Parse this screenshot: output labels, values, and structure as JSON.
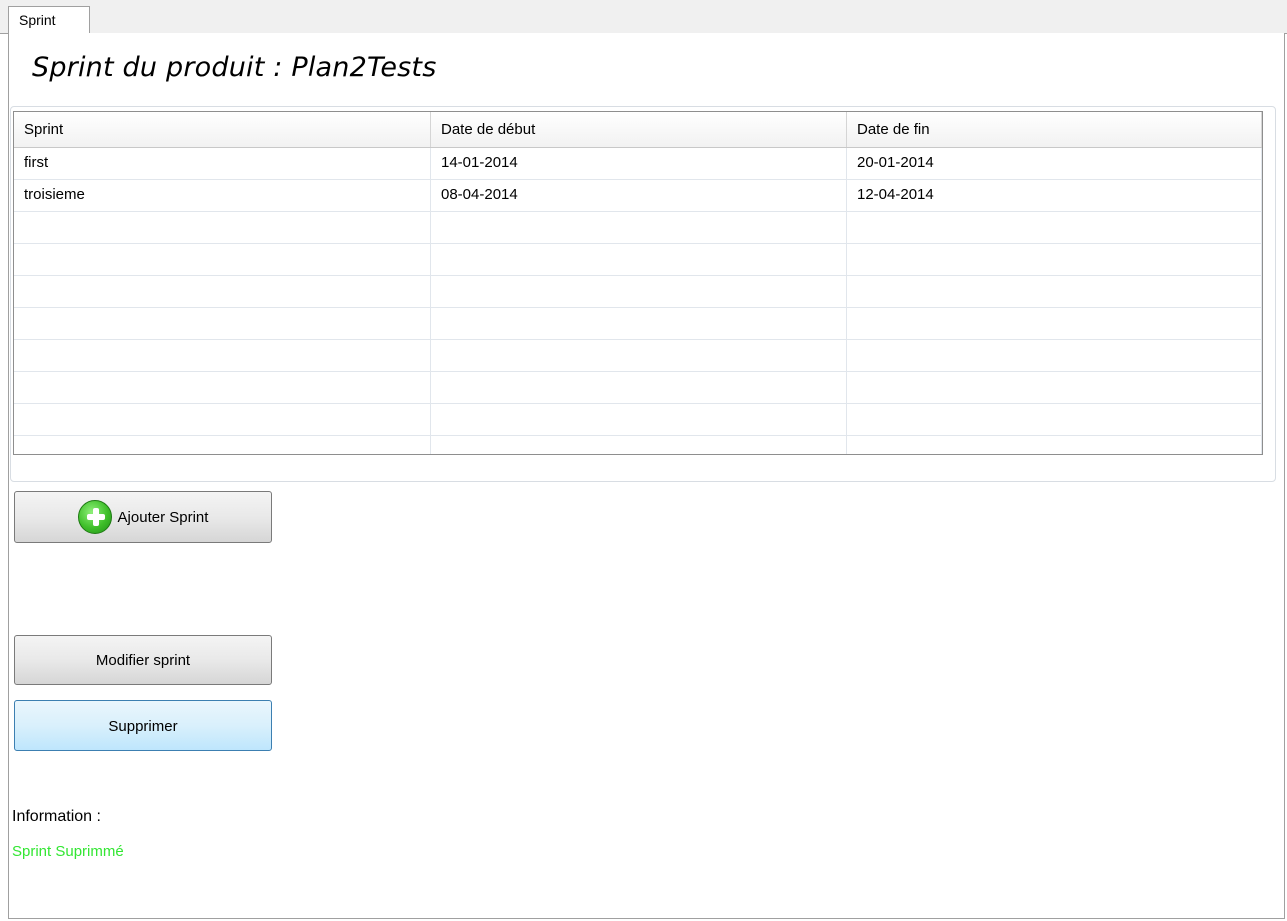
{
  "tab": {
    "label": "Sprint"
  },
  "title": "Sprint du produit : Plan2Tests",
  "table": {
    "columns": [
      "Sprint",
      "Date de début",
      "Date de fin"
    ],
    "rows": [
      [
        "first",
        "14-01-2014",
        "20-01-2014"
      ],
      [
        "troisieme",
        "08-04-2014",
        "12-04-2014"
      ]
    ]
  },
  "buttons": {
    "add_label": "Ajouter Sprint",
    "modify_label": "Modifier sprint",
    "delete_label": "Supprimer"
  },
  "info": {
    "label": "Information :",
    "message": "Sprint Suprimmé",
    "message_color": "#33e633"
  },
  "icons": {
    "add": "plus-circle-icon"
  }
}
